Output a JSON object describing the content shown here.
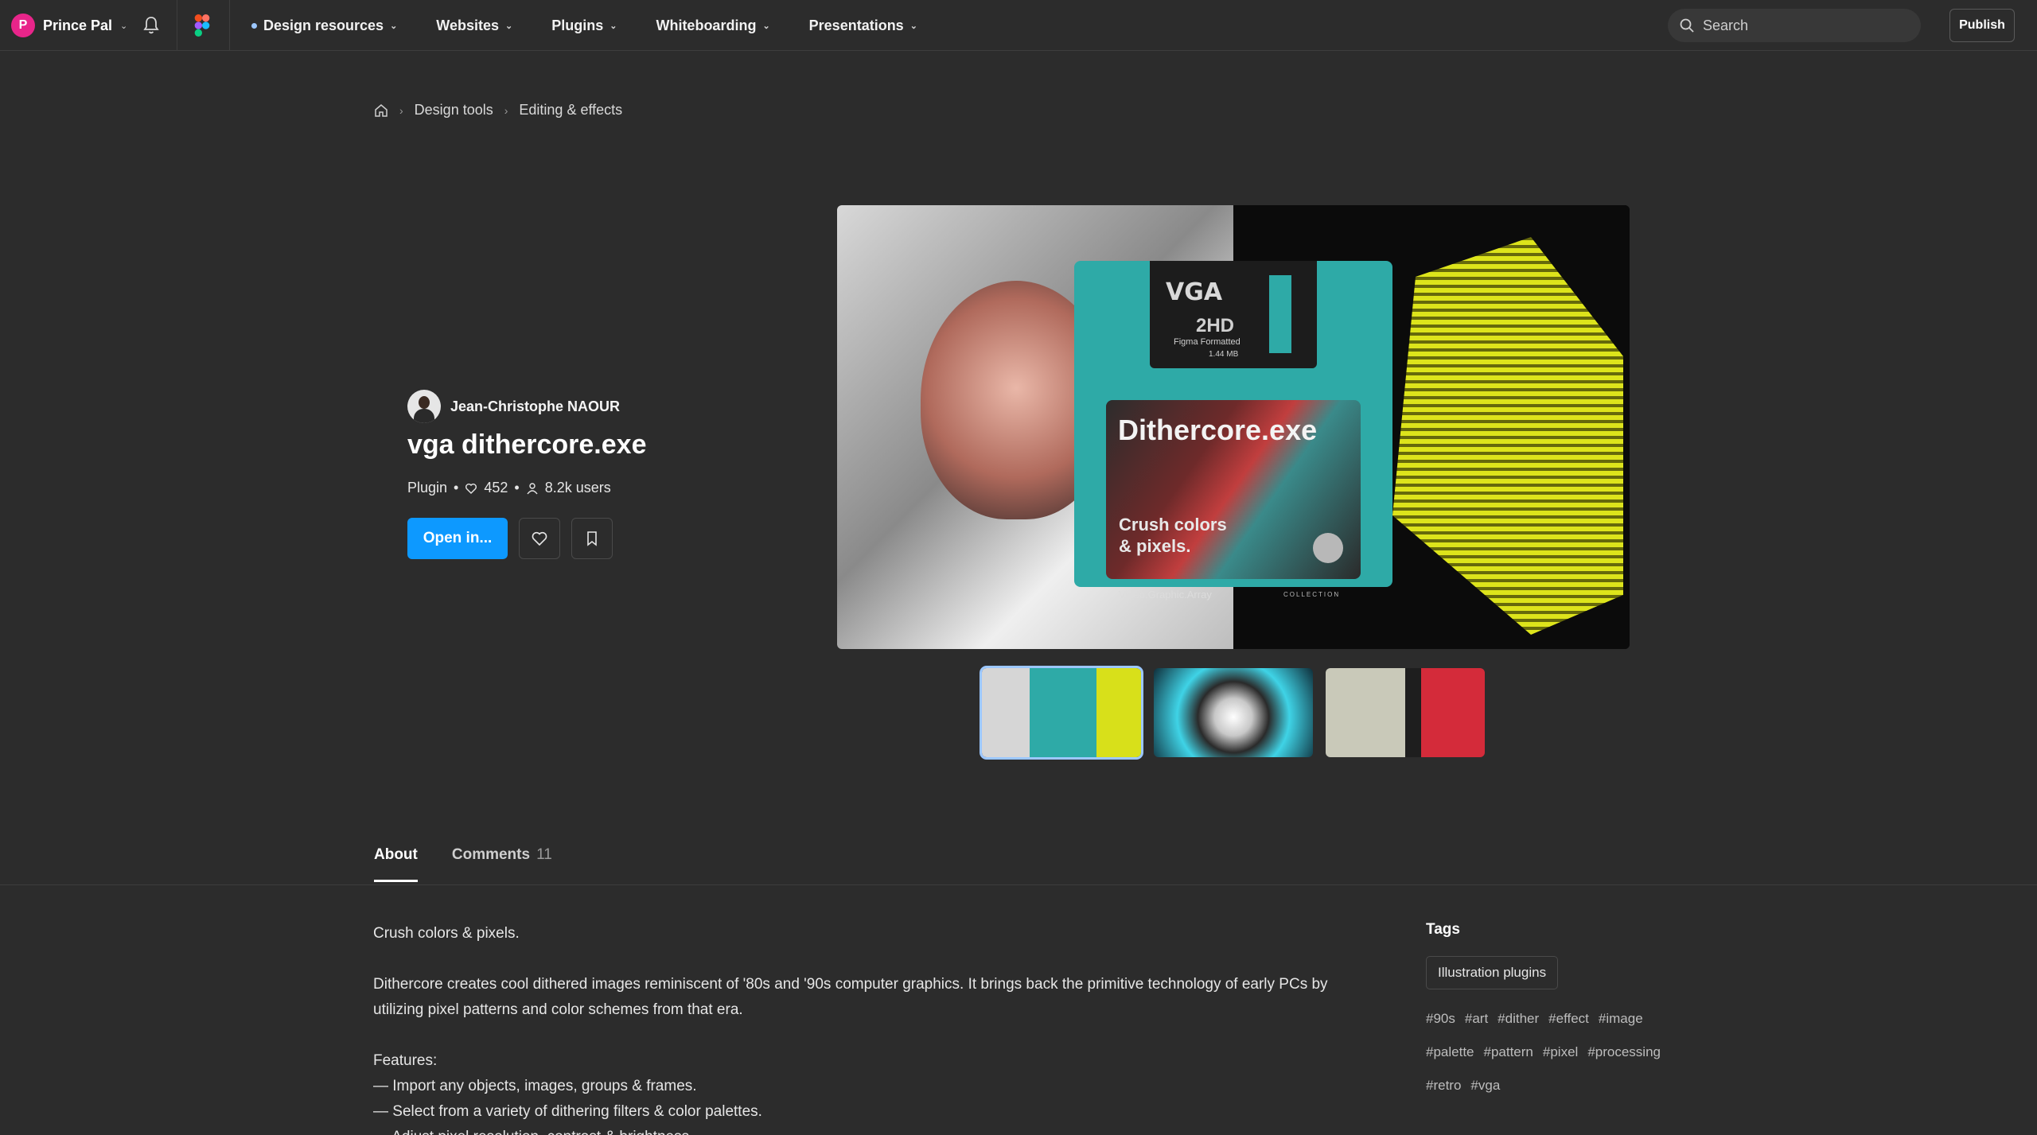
{
  "topbar": {
    "user": {
      "initial": "P",
      "name": "Prince Pal"
    },
    "nav": [
      {
        "label": "Design resources",
        "active": true
      },
      {
        "label": "Websites"
      },
      {
        "label": "Plugins"
      },
      {
        "label": "Whiteboarding"
      },
      {
        "label": "Presentations"
      }
    ],
    "search_placeholder": "Search",
    "publish_label": "Publish"
  },
  "breadcrumb": [
    "Design tools",
    "Editing & effects"
  ],
  "plugin": {
    "author": "Jean-Christophe NAOUR",
    "title": "vga dithercore.exe",
    "type": "Plugin",
    "likes": "452",
    "users": "8.2k users",
    "open_label": "Open in..."
  },
  "hero": {
    "floppy_brand": "VGA",
    "floppy_capacity": "2HD",
    "floppy_formatted": "Figma Formatted",
    "floppy_size": "1.44 MB",
    "floppy_title": "Dithercore.exe",
    "floppy_tagline": "Crush colors & pixels.",
    "floppy_footer": "Video.Graphic.Array",
    "floppy_collection": "COLLECTION"
  },
  "tabs": [
    {
      "label": "About",
      "active": true
    },
    {
      "label": "Comments",
      "count": "11"
    }
  ],
  "about": {
    "tagline": "Crush colors & pixels.",
    "description": "Dithercore creates cool dithered images reminiscent of '80s and '90s computer graphics. It brings back the primitive technology of early PCs by utilizing pixel patterns and color schemes from that era.",
    "features_title": "Features:",
    "features": [
      "— Import any objects, images, groups & frames.",
      "— Select from a variety of dithering filters & color palettes.",
      "— Adjust pixel resolution, contrast & brightness."
    ]
  },
  "tags": {
    "title": "Tags",
    "category": "Illustration plugins",
    "hashtags": [
      "#90s",
      "#art",
      "#dither",
      "#effect",
      "#image",
      "#palette",
      "#pattern",
      "#pixel",
      "#processing",
      "#retro",
      "#vga"
    ]
  },
  "colors": {
    "background": "#2c2c2c",
    "primary_button": "#0d99ff",
    "avatar_pink": "#e8258a",
    "thumb_active_outline": "#9cc7ff"
  }
}
